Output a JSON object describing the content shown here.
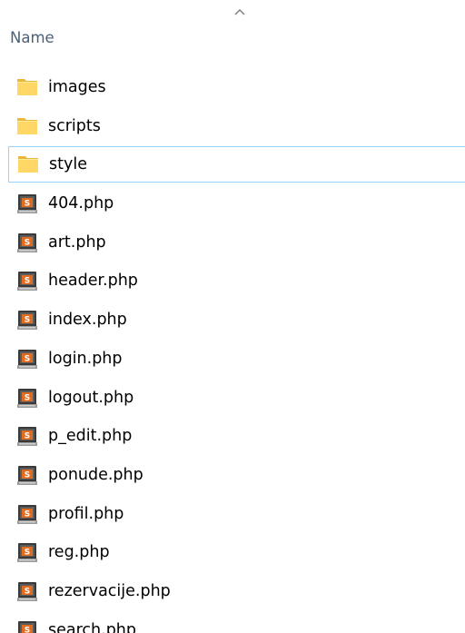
{
  "header": {
    "column_name": "Name",
    "sort_icon": "chevron-up-icon"
  },
  "files": [
    {
      "name": "images",
      "type": "folder",
      "icon": "folder-icon",
      "selected": false
    },
    {
      "name": "scripts",
      "type": "folder",
      "icon": "folder-icon",
      "selected": false
    },
    {
      "name": "style",
      "type": "folder",
      "icon": "folder-icon",
      "selected": true
    },
    {
      "name": "404.php",
      "type": "php",
      "icon": "php-file-icon",
      "selected": false
    },
    {
      "name": "art.php",
      "type": "php",
      "icon": "php-file-icon",
      "selected": false
    },
    {
      "name": "header.php",
      "type": "php",
      "icon": "php-file-icon",
      "selected": false
    },
    {
      "name": "index.php",
      "type": "php",
      "icon": "php-file-icon",
      "selected": false
    },
    {
      "name": "login.php",
      "type": "php",
      "icon": "php-file-icon",
      "selected": false
    },
    {
      "name": "logout.php",
      "type": "php",
      "icon": "php-file-icon",
      "selected": false
    },
    {
      "name": "p_edit.php",
      "type": "php",
      "icon": "php-file-icon",
      "selected": false
    },
    {
      "name": "ponude.php",
      "type": "php",
      "icon": "php-file-icon",
      "selected": false
    },
    {
      "name": "profil.php",
      "type": "php",
      "icon": "php-file-icon",
      "selected": false
    },
    {
      "name": "reg.php",
      "type": "php",
      "icon": "php-file-icon",
      "selected": false
    },
    {
      "name": "rezervacije.php",
      "type": "php",
      "icon": "php-file-icon",
      "selected": false
    },
    {
      "name": "search.php",
      "type": "php",
      "icon": "php-file-icon",
      "selected": false
    }
  ],
  "colors": {
    "header_text": "#4c607a",
    "selection_border": "#99d1ff",
    "folder_fill": "#ffd766",
    "folder_tab": "#e8b73c",
    "php_icon_dark": "#3a3a3a",
    "php_icon_accent": "#e06c1f"
  }
}
